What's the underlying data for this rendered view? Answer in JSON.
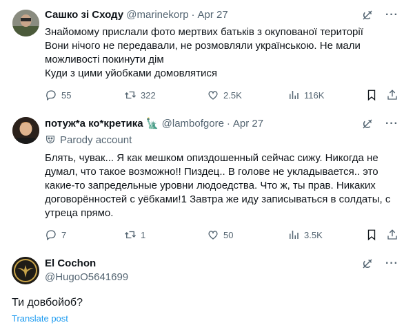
{
  "tweets": [
    {
      "name": "Сашко зі Сходу",
      "handle": "@marinekorp",
      "date": "Apr 27",
      "text": [
        "Знайомому прислали фото мертвих батьків з окупованої території",
        "Вони нічого не передавали, не розмовляли українською. Не мали",
        "можливості покинути дім",
        "Куди з цими уйобками домовлятися"
      ],
      "replies": "55",
      "reposts": "322",
      "likes": "2.5K",
      "views": "116K"
    },
    {
      "name": "потуж*а ко*кретика 🗽",
      "handle": "@lambofgore",
      "date": "Apr 27",
      "parody_label": "Parody account",
      "text": [
        "Блять, чувак... Я как мешком опиздошенный сейчас сижу. Никогда не",
        "думал, что такое возможно!! Пиздец.. В голове не укладывается.. это",
        "какие-то запредельные уровни людоедства. Что ж, ты прав. Никаких",
        "договорённостей с уёбками!1 Завтра же иду записываться в солдаты, с",
        "утреца прямо."
      ],
      "replies": "7",
      "reposts": "1",
      "likes": "50",
      "views": "3.5K"
    },
    {
      "name": "El Cochon",
      "handle": "@HugoO5641699",
      "text": "Ти довбойоб?",
      "translate": "Translate post"
    }
  ],
  "colors": {
    "text": "#0f1419",
    "secondary": "#536471",
    "link": "#1d9bf0"
  },
  "icons": [
    "reply-icon",
    "repost-icon",
    "like-icon",
    "views-icon",
    "bookmark-icon",
    "share-icon",
    "grok-icon",
    "more-icon"
  ]
}
